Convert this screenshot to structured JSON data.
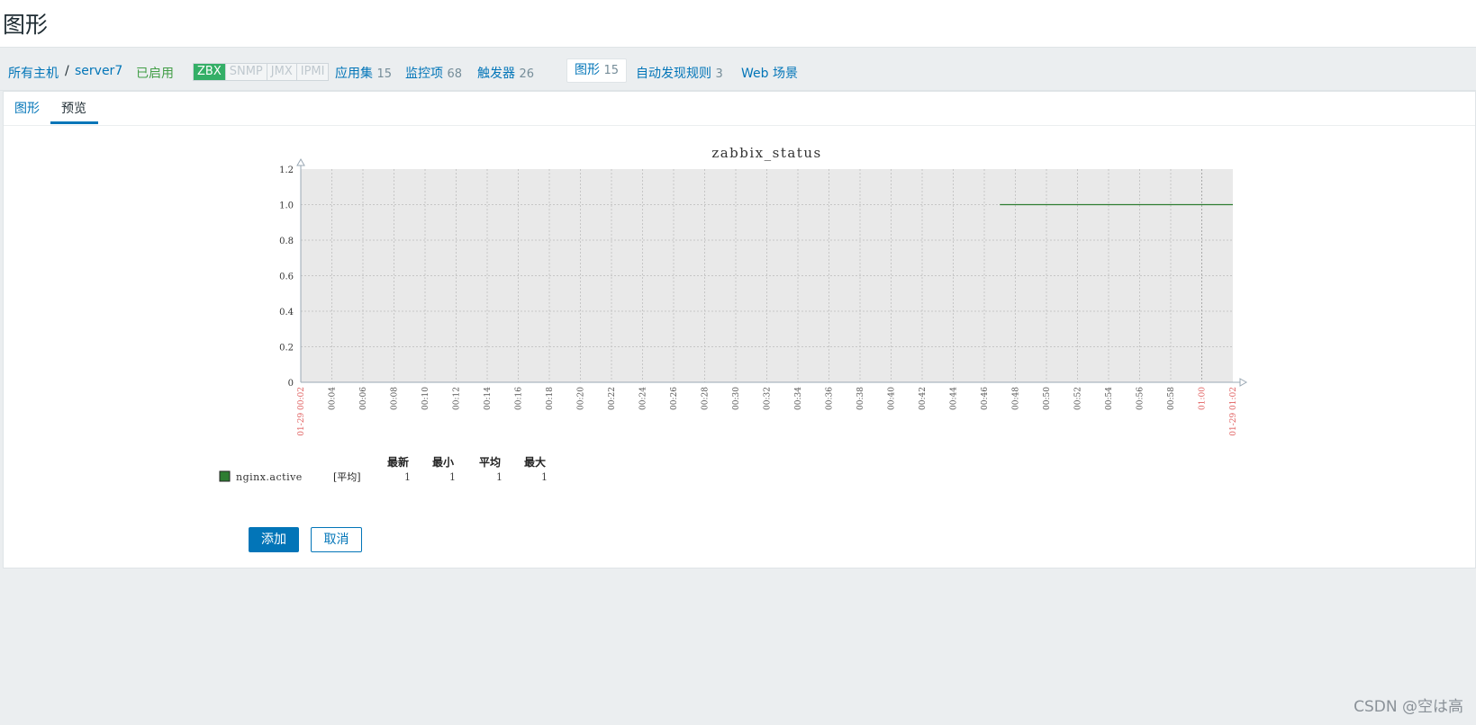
{
  "page": {
    "title": "图形"
  },
  "hostbar": {
    "all_hosts": "所有主机",
    "separator": "/",
    "host": "server7",
    "status": "已启用",
    "availability": [
      "ZBX",
      "SNMP",
      "JMX",
      "IPMI"
    ],
    "nav": [
      {
        "label": "应用集",
        "count": "15"
      },
      {
        "label": "监控项",
        "count": "68"
      },
      {
        "label": "触发器",
        "count": "26"
      },
      {
        "label": "图形",
        "count": "15"
      },
      {
        "label": "自动发现规则",
        "count": "3"
      },
      {
        "label": "Web 场景",
        "count": ""
      }
    ]
  },
  "tabs": [
    {
      "label": "图形"
    },
    {
      "label": "预览"
    }
  ],
  "chart_data": {
    "type": "line",
    "title": "zabbix_status",
    "ylim": [
      0,
      1.2
    ],
    "y_ticks": [
      "0",
      "0.2",
      "0.4",
      "0.6",
      "0.8",
      "1.0",
      "1.2"
    ],
    "x_ticks": [
      "00:04",
      "00:06",
      "00:08",
      "00:10",
      "00:12",
      "00:14",
      "00:16",
      "00:18",
      "00:20",
      "00:22",
      "00:24",
      "00:26",
      "00:28",
      "00:30",
      "00:32",
      "00:34",
      "00:36",
      "00:38",
      "00:40",
      "00:42",
      "00:44",
      "00:46",
      "00:48",
      "00:50",
      "00:52",
      "00:54",
      "00:56",
      "00:58",
      "01:00"
    ],
    "x_start_label": "01-29 00:02",
    "x_end_label": "01-29 01:02",
    "grid": true,
    "series": [
      {
        "name": "nginx.active",
        "color": "#2e7d32",
        "function": "[平均]",
        "x": [
          "00:47",
          "01:02"
        ],
        "values": [
          1,
          1
        ]
      }
    ],
    "legend": {
      "headers": [
        "最新",
        "最小",
        "平均",
        "最大"
      ],
      "rows": [
        {
          "name": "nginx.active",
          "function": "[平均]",
          "last": "1",
          "min": "1",
          "avg": "1",
          "max": "1"
        }
      ]
    }
  },
  "buttons": {
    "add": "添加",
    "cancel": "取消"
  },
  "watermark": "CSDN @空は高"
}
